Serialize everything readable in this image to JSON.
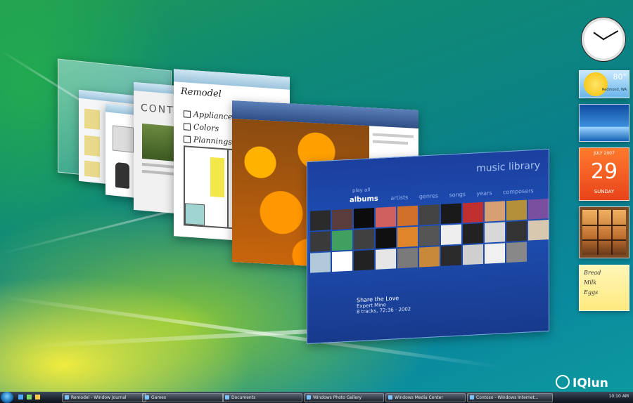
{
  "windows": {
    "journal": {
      "taskbar_label": "Remodel - Windows Journal",
      "heading": "Remodel",
      "items": [
        "Appliances",
        "Colors",
        "Plannings"
      ]
    },
    "media_center": {
      "title": "music library",
      "breadcrumb": "play all",
      "nav_tabs": [
        "albums",
        "artists",
        "genres",
        "songs",
        "years",
        "composers"
      ],
      "selected_tab": "albums",
      "track": "Share the Love",
      "artist": "Expert Mine",
      "details": "8 tracks, 72:36 · 2002"
    }
  },
  "gadgets": {
    "weather": {
      "temp": "80°",
      "location": "Redmond, WA"
    },
    "calendar": {
      "month": "JULY 2007",
      "day": "29",
      "weekday": "SUNDAY"
    },
    "notes": {
      "lines": [
        "Bread",
        "Milk",
        "Eggs"
      ]
    }
  },
  "taskbar": {
    "items": [
      "Remodel - Window Journal",
      "Games",
      "Documents",
      "Windows Photo Gallery",
      "Windows Media Center",
      "Contoso - Windows Internet..."
    ],
    "clock": "10:10 AM"
  },
  "watermark": "IQlun",
  "colors": {
    "desktop_teal": "#0a7f8c",
    "media_blue": "#1e4fb4",
    "calendar_orange": "#ff7a2d"
  }
}
